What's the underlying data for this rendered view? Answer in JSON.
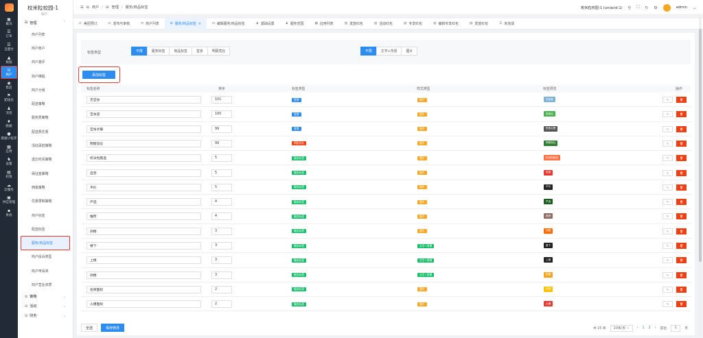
{
  "rail": {
    "items": [
      {
        "icon": "▣",
        "label": "概况"
      },
      {
        "icon": "☰",
        "label": "订单"
      },
      {
        "icon": "☰",
        "label": "当面付"
      },
      {
        "icon": "▲",
        "label": "数据"
      },
      {
        "icon": "⊟",
        "label": "商户"
      },
      {
        "icon": "◉",
        "label": "售后"
      },
      {
        "icon": "⚑",
        "label": "配送员"
      },
      {
        "icon": "♟",
        "label": "消息"
      },
      {
        "icon": "♦",
        "label": "跑腿"
      },
      {
        "icon": "●",
        "label": "跑腿小程序"
      },
      {
        "icon": "▦",
        "label": "应用"
      },
      {
        "icon": "♞",
        "label": "设置"
      },
      {
        "icon": "▤",
        "label": "权限"
      },
      {
        "icon": "☁",
        "label": "云服务"
      },
      {
        "icon": "▣",
        "label": "供应管理"
      },
      {
        "icon": "▪",
        "label": "系统"
      }
    ],
    "active_index": 4
  },
  "sidebar": {
    "store_name": "校米粒校园-1",
    "store_sub": "商户",
    "group_manage": "管理",
    "items": [
      "商户列表",
      "商户账户",
      "商户邀评",
      "商户横幅",
      "商户分组",
      "配送策略",
      "服务费策略",
      "配送费优惠",
      "活动承担策略",
      "送达时间策略",
      "保证金策略",
      "佣金策略",
      "优惠限制策略",
      "商户标签",
      "配送标签",
      "服务/商品标签",
      "商户投诉类型",
      "商户申请单",
      "商户营业资质"
    ],
    "active_item": "服务/商品标签",
    "groups_bottom": [
      "策略",
      "活动",
      "财务"
    ]
  },
  "topbar": {
    "crumbs": [
      "商户",
      "管理",
      "服务/商品标签"
    ],
    "store": "校米粒校园-1 (uniacid:1)",
    "user": "admin"
  },
  "tabs": [
    {
      "label": "美团预订",
      "icon": "⇄"
    },
    {
      "label": "发布与审核",
      "icon": "⇄"
    },
    {
      "label": "商户列表",
      "icon": "⊟"
    },
    {
      "label": "服务/商品标签",
      "icon": "⊟",
      "active": true
    },
    {
      "label": "编辑服务/商品标签",
      "icon": "⊟"
    },
    {
      "label": "基础设置",
      "icon": "♟"
    },
    {
      "label": "服务范围",
      "icon": "♟"
    },
    {
      "label": "应用列表",
      "icon": "▦"
    },
    {
      "label": "发放红包",
      "icon": "▤"
    },
    {
      "label": "活动红包",
      "icon": "▤"
    },
    {
      "label": "专享红包",
      "icon": "▤"
    },
    {
      "label": "编辑专享红包",
      "icon": "▤"
    },
    {
      "label": "发放红包",
      "icon": "▤"
    },
    {
      "label": "未完成",
      "icon": "☰"
    }
  ],
  "filter": {
    "label": "标签类型",
    "type_options": [
      "不限",
      "服务标签",
      "商品标签",
      "堂食",
      "明厨亮灶"
    ],
    "style_options": [
      "不限",
      "文字+背景",
      "图片"
    ]
  },
  "add_button": "添加标签",
  "table": {
    "headers": {
      "name": "标签名称",
      "order": "排序",
      "type": "标签类型",
      "style": "样式类型",
      "preview": "标签预览",
      "ops": "操作"
    },
    "rows": [
      {
        "name": "无堂食",
        "order": "101",
        "type": "堂食",
        "type_color": "#2d8cf0",
        "style": "图片",
        "style_color": "#f5a623",
        "preview": "无堂食",
        "preview_color": "#7fb3d5"
      },
      {
        "name": "堂食店",
        "order": "100",
        "type": "堂食",
        "type_color": "#2d8cf0",
        "style": "图片",
        "style_color": "#f5a623",
        "preview": "堂食店",
        "preview_color": "#4caf50"
      },
      {
        "name": "堂食点餐",
        "order": "99",
        "type": "堂食",
        "type_color": "#2d8cf0",
        "style": "图片",
        "style_color": "#f5a623",
        "preview": "堂食点餐",
        "preview_color": "#555555"
      },
      {
        "name": "明厨亮灶",
        "order": "99",
        "type": "明厨亮灶",
        "type_color": "#ed4014",
        "style": "图片",
        "style_color": "#f5a623",
        "preview": "明厨亮灶",
        "preview_color": "#2e7d32"
      },
      {
        "name": "校米粒甄选",
        "order": "5",
        "type": "服务标签",
        "type_color": "#19be6b",
        "style": "图片",
        "style_color": "#f5a623",
        "preview": "校米粒甄选",
        "preview_color": "#ff7043"
      },
      {
        "name": "自营",
        "order": "5",
        "type": "服务标签",
        "type_color": "#19be6b",
        "style": "图片",
        "style_color": "#f5a623",
        "preview": "自营",
        "preview_color": "#e53935"
      },
      {
        "name": "平价",
        "order": "5",
        "type": "服务标签",
        "type_color": "#19be6b",
        "style": "图片",
        "style_color": "#f5a623",
        "preview": "平价",
        "preview_color": "#222222"
      },
      {
        "name": "严选",
        "order": "4",
        "type": "服务标签",
        "type_color": "#19be6b",
        "style": "图片",
        "style_color": "#f5a623",
        "preview": "严选",
        "preview_color": "#1b5e20"
      },
      {
        "name": "推荐",
        "order": "4",
        "type": "服务标签",
        "type_color": "#19be6b",
        "style": "图片",
        "style_color": "#f5a623",
        "preview": "推荐",
        "preview_color": "#8d6e63"
      },
      {
        "name": "到楼",
        "order": "3",
        "type": "服务标签",
        "type_color": "#19be6b",
        "style": "图片",
        "style_color": "#f5a623",
        "preview": "到楼",
        "preview_color": "#ff6d00"
      },
      {
        "name": "楼下",
        "order": "3",
        "type": "服务标签",
        "type_color": "#19be6b",
        "style": "文字+背景",
        "style_color": "#19be6b",
        "preview": "楼下",
        "preview_color": "#222222"
      },
      {
        "name": "上楼",
        "order": "3",
        "type": "服务标签",
        "type_color": "#19be6b",
        "style": "文字+背景",
        "style_color": "#19be6b",
        "preview": "上楼",
        "preview_color": "#222222"
      },
      {
        "name": "到楼",
        "order": "3",
        "type": "服务标签",
        "type_color": "#19be6b",
        "style": "文字+背景",
        "style_color": "#19be6b",
        "preview": "到楼",
        "preview_color": "#f5a623"
      },
      {
        "name": "名牌图标",
        "order": "2",
        "type": "服务标签",
        "type_color": "#19be6b",
        "style": "图片",
        "style_color": "#f5a623",
        "preview": "名牌",
        "preview_color": "#ffc107"
      },
      {
        "name": "火爆图标",
        "order": "2",
        "type": "服务标签",
        "type_color": "#19be6b",
        "style": "图片",
        "style_color": "#f5a623",
        "preview": "火爆",
        "preview_color": "#e53935"
      }
    ],
    "edit_icon": "✎",
    "delete_icon": "🗑"
  },
  "footer": {
    "select_all": "全选",
    "save": "保存修改",
    "total": "共 25 条",
    "page_size": "20条/页",
    "pages": [
      "1",
      "2"
    ],
    "current_page": "1",
    "goto_label": "前往",
    "goto_value": "1",
    "page_suffix": "页"
  }
}
